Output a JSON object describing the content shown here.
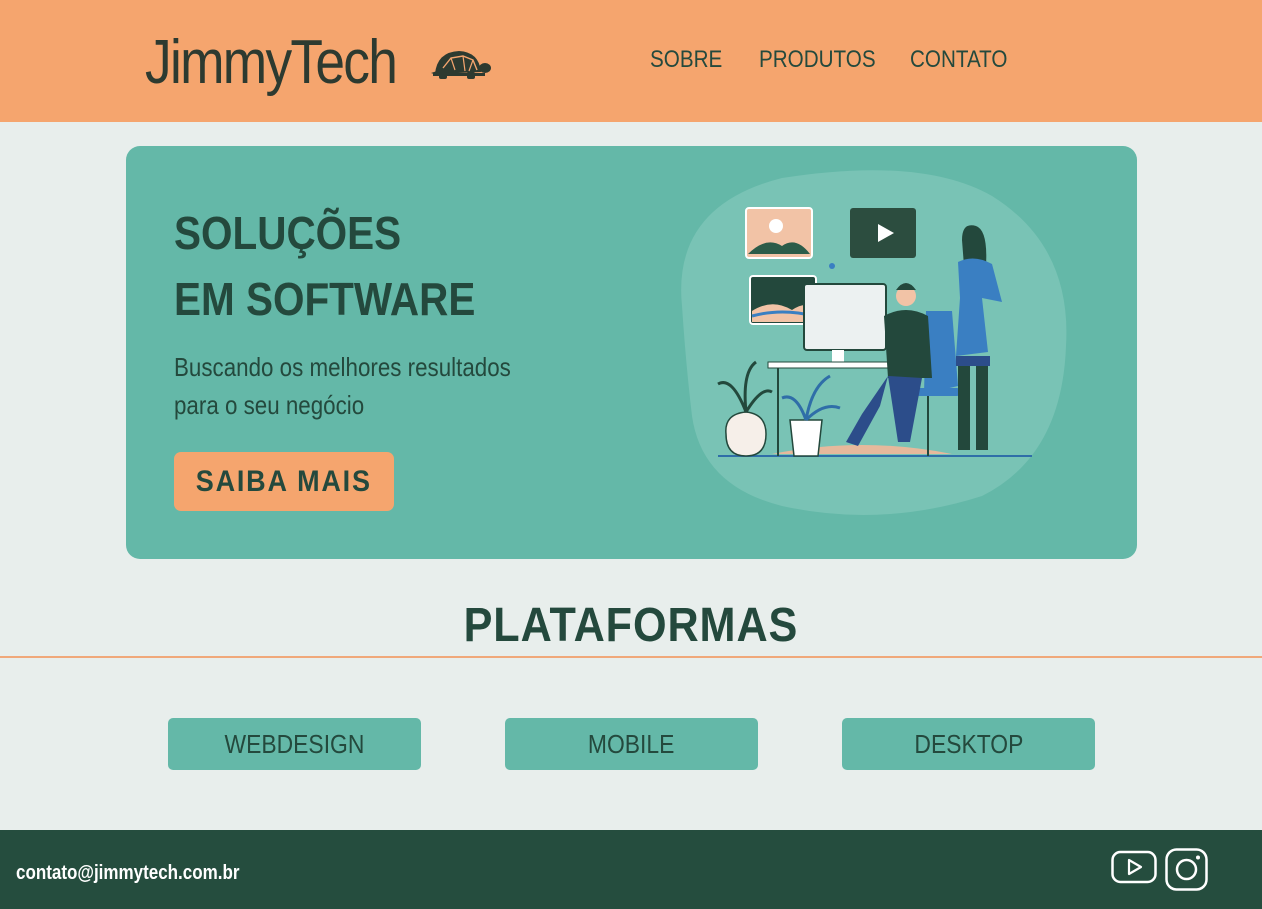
{
  "header": {
    "logo_text": "JimmyTech",
    "nav": [
      "SOBRE",
      "PRODUTOS",
      "CONTATO"
    ]
  },
  "hero": {
    "title_line1": "SOLUÇÕES",
    "title_line2": "EM SOFTWARE",
    "subtitle_line1": "Buscando os melhores resultados",
    "subtitle_line2": "para o seu negócio",
    "cta_label": "SAIBA MAIS"
  },
  "platforms": {
    "title": "PLATAFORMAS",
    "items": [
      "WEBDESIGN",
      "MOBILE",
      "DESKTOP"
    ]
  },
  "footer": {
    "email": "contato@jimmytech.com.br",
    "social_icons": [
      "youtube-icon",
      "instagram-icon"
    ]
  },
  "colors": {
    "header_bg": "#f5a56e",
    "accent_teal": "#64b8a8",
    "dark_green": "#24493d",
    "footer_bg": "#254d3e",
    "page_bg": "#e8eeec"
  }
}
